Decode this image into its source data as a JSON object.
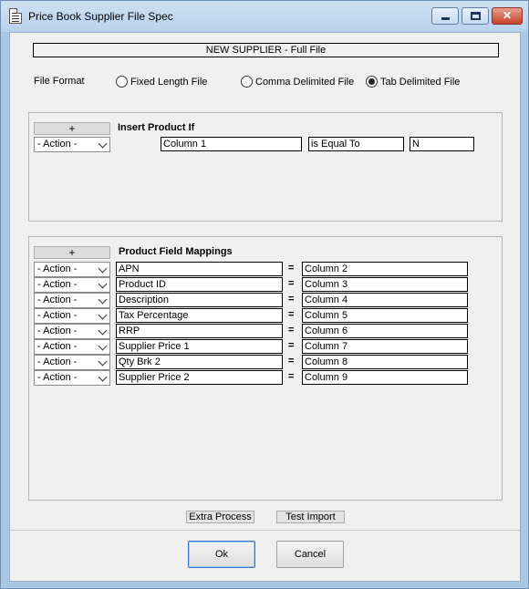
{
  "window": {
    "title": "Price Book Supplier File Spec",
    "close_glyph": "✕"
  },
  "header": {
    "supplier_title": "NEW SUPPLIER - Full File"
  },
  "file_format": {
    "label": "File Format",
    "options": [
      {
        "label": "Fixed Length File",
        "selected": false
      },
      {
        "label": "Comma Delimited File",
        "selected": false
      },
      {
        "label": "Tab Delimited File",
        "selected": true
      }
    ]
  },
  "insert_product_if": {
    "add_label": "+",
    "title": "Insert Product If",
    "action": "- Action -",
    "column": "Column 1",
    "operator": "is Equal To",
    "value": "N"
  },
  "product_field_mappings": {
    "add_label": "+",
    "title": "Product Field Mappings",
    "equals_symbol": "=",
    "rows": [
      {
        "action": "- Action -",
        "field": "APN",
        "column": "Column 2"
      },
      {
        "action": "- Action -",
        "field": "Product ID",
        "column": "Column 3"
      },
      {
        "action": "- Action -",
        "field": "Description",
        "column": "Column 4"
      },
      {
        "action": "- Action -",
        "field": "Tax Percentage",
        "column": "Column 5"
      },
      {
        "action": "- Action -",
        "field": "RRP",
        "column": "Column 6"
      },
      {
        "action": "- Action -",
        "field": "Supplier Price 1",
        "column": "Column 7"
      },
      {
        "action": "- Action -",
        "field": "Qty Brk 2",
        "column": "Column 8"
      },
      {
        "action": "- Action -",
        "field": "Supplier Price 2",
        "column": "Column 9"
      }
    ]
  },
  "actions": {
    "extra_process": "Extra Process",
    "test_import": "Test Import"
  },
  "footer": {
    "ok": "Ok",
    "cancel": "Cancel"
  }
}
